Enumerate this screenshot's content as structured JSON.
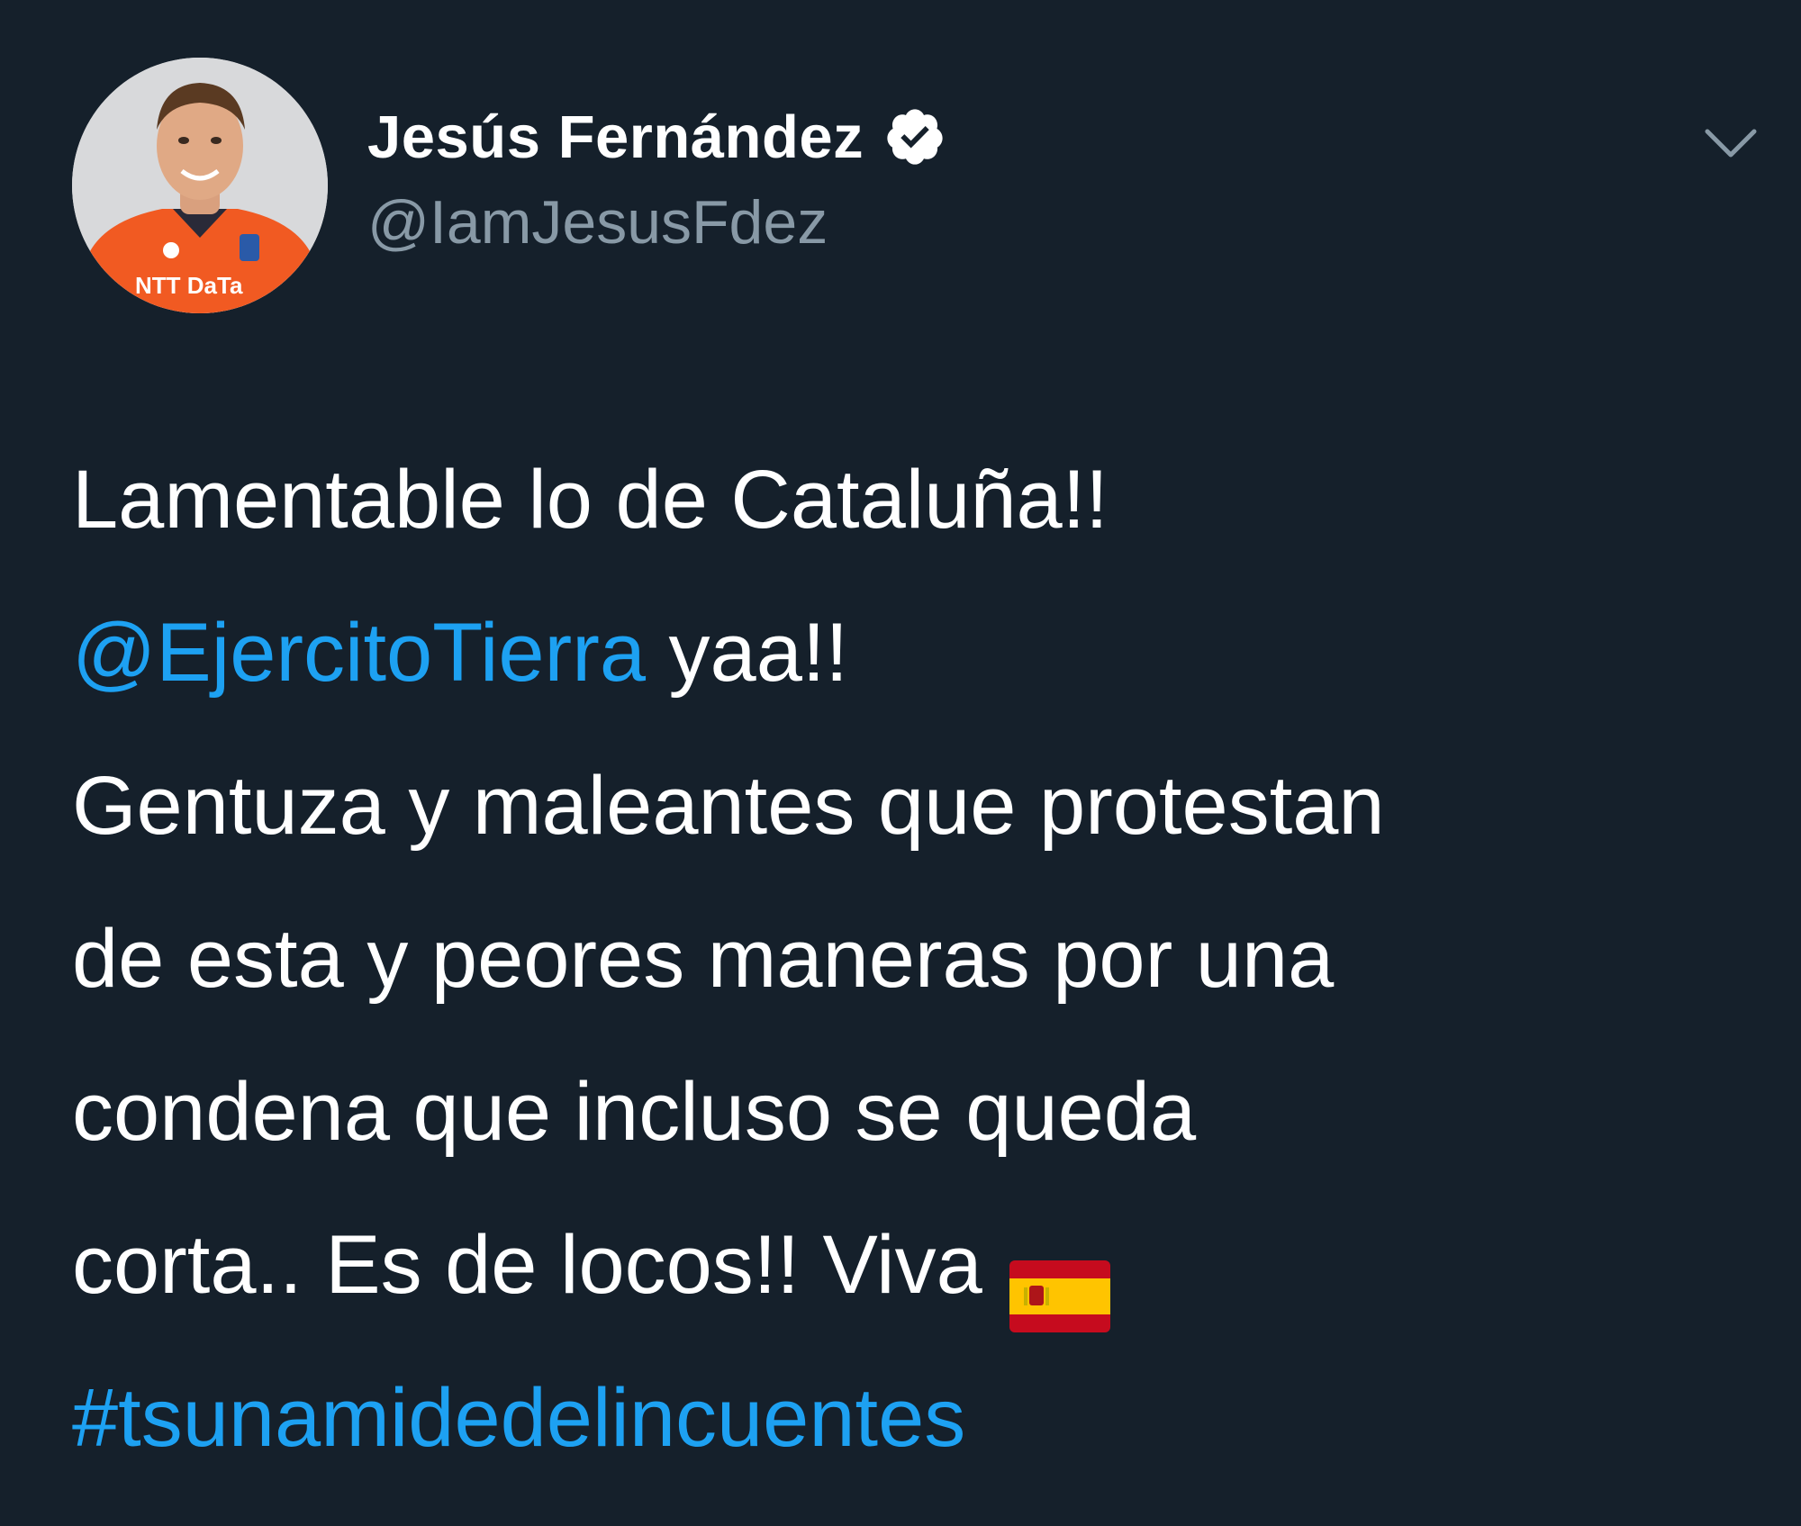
{
  "tweet": {
    "author": {
      "display_name": "Jesús Fernández",
      "handle": "@IamJesusFdez",
      "avatar_brand_text": "NTT DaTa"
    },
    "text": {
      "line1": "Lamentable lo de Cataluña!!",
      "mention": "@EjercitoTierra",
      "line2_rest": " yaa!!",
      "line3": "Gentuza y maleantes que protestan",
      "line4": "de esta y peores maneras por una",
      "line5": "condena que incluso se queda",
      "line6": "corta.. Es de locos!! Viva",
      "hashtag": "#tsunamidedelincuentes"
    },
    "icons": {
      "verified": "verified-badge-icon",
      "caret": "chevron-down-icon",
      "flag": "spain-flag-emoji"
    },
    "colors": {
      "background": "#15202b",
      "link": "#1da1f2",
      "secondary_text": "#8899a6",
      "primary_text": "#ffffff"
    }
  }
}
